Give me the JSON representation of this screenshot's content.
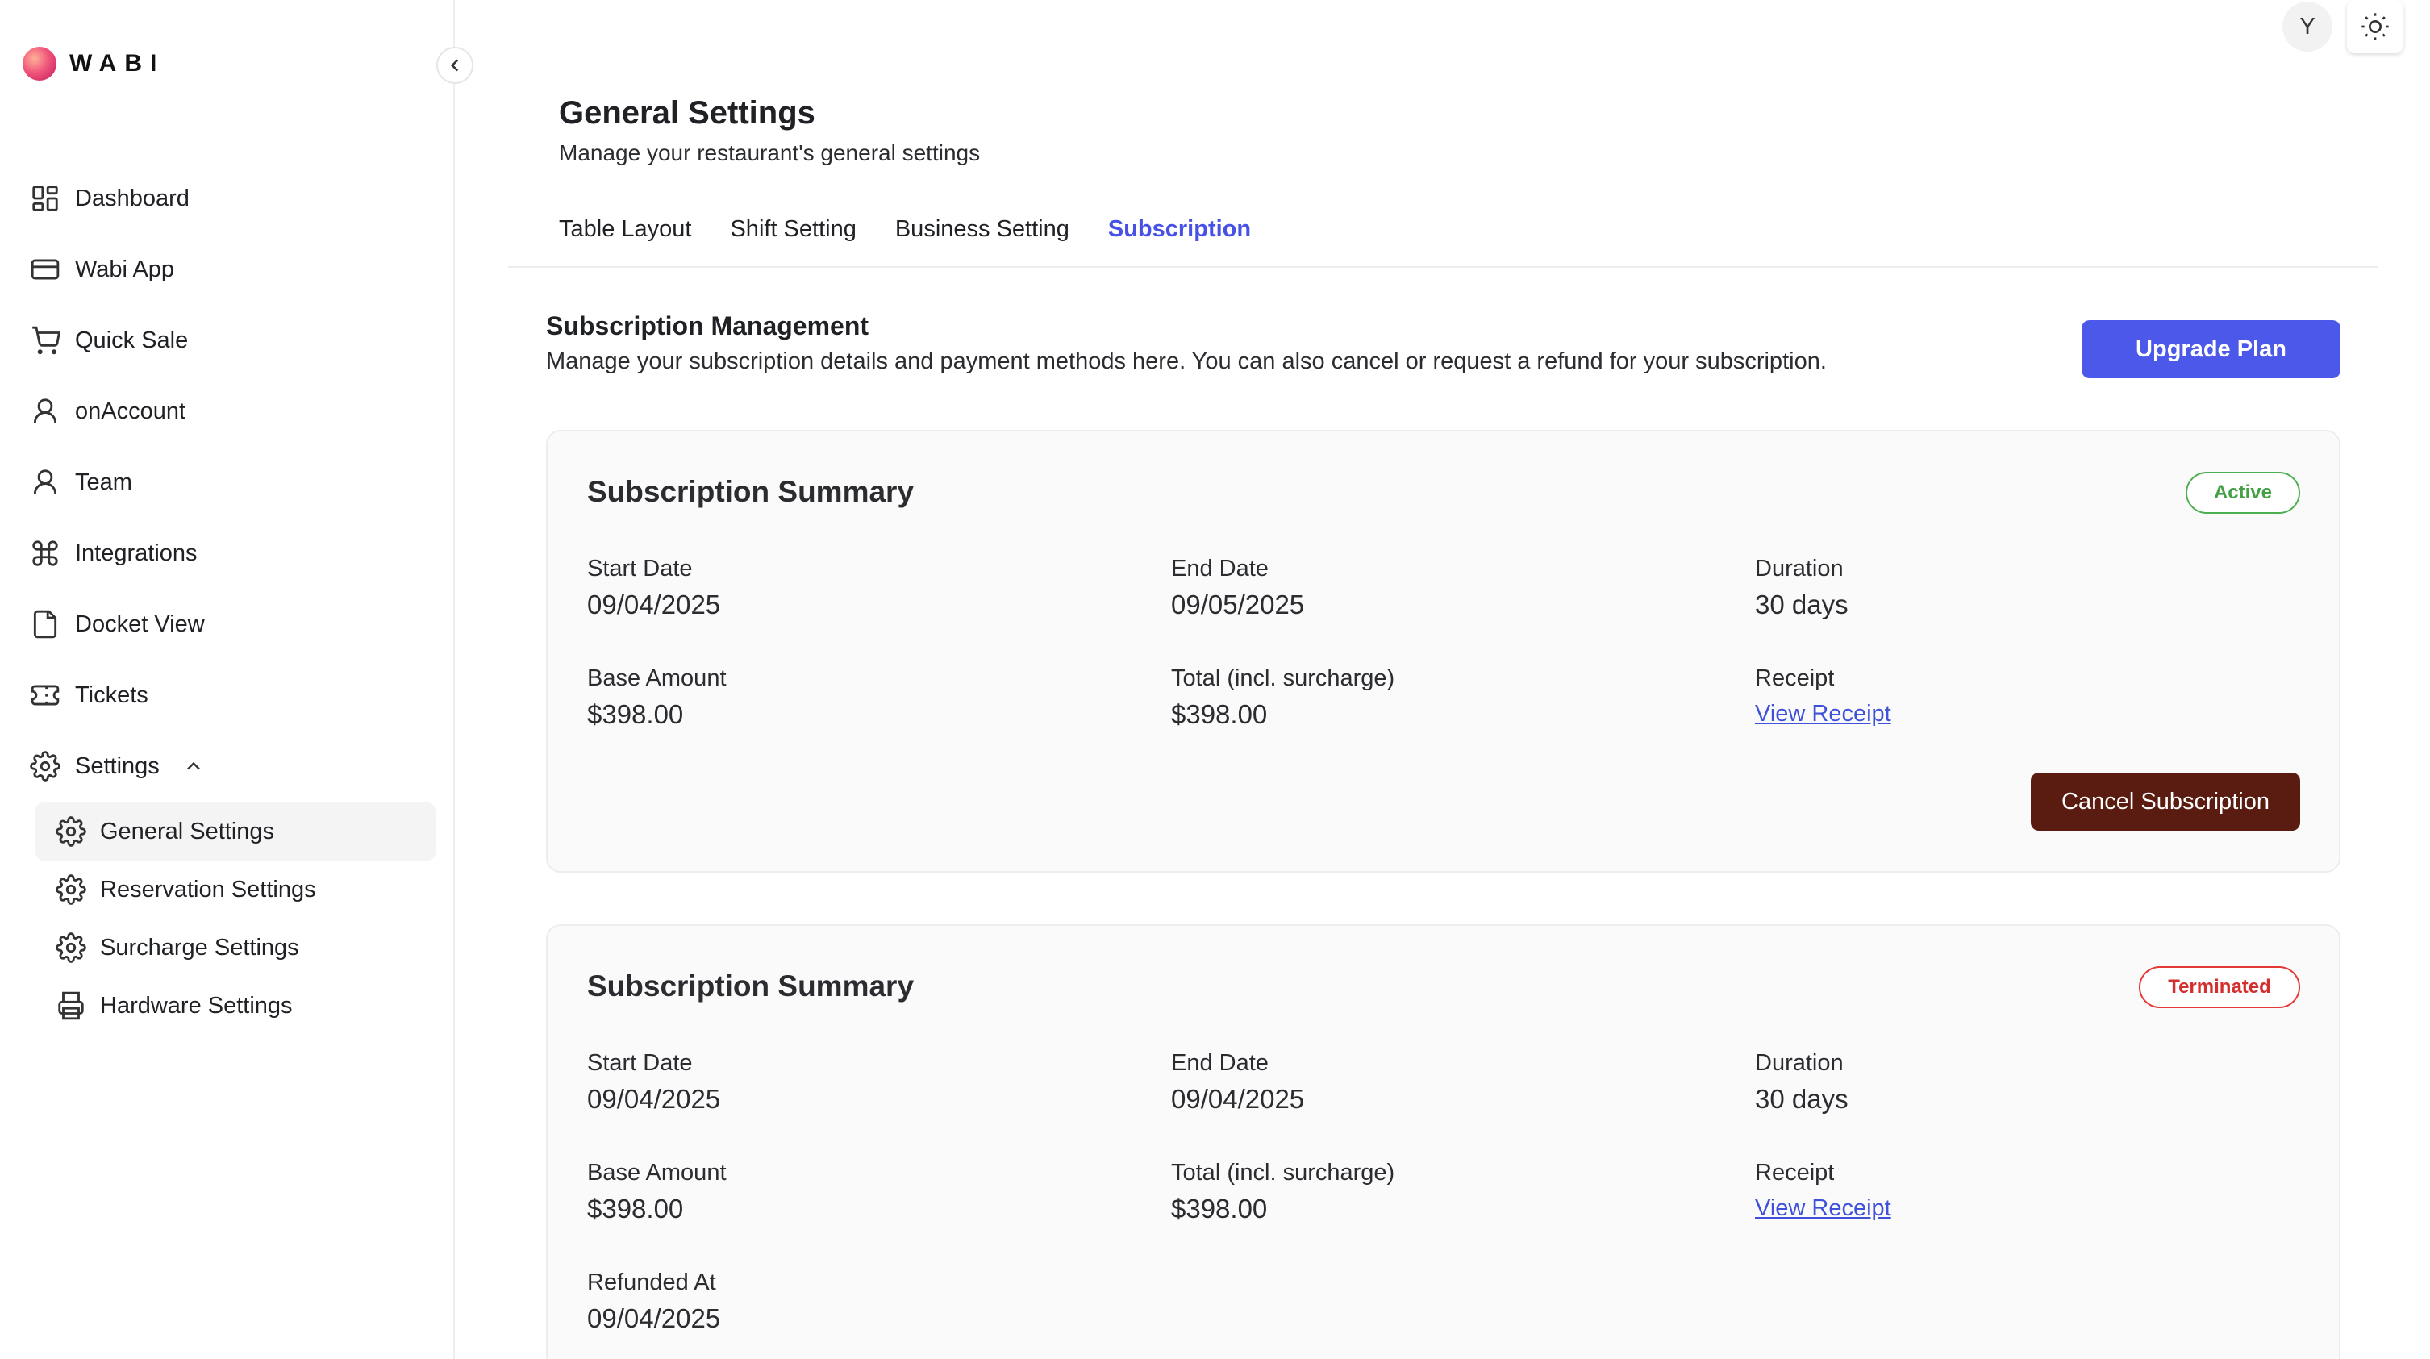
{
  "brand": {
    "name": "WABI"
  },
  "user": {
    "initial": "Y"
  },
  "sidebar": {
    "items": [
      {
        "label": "Dashboard",
        "icon": "dashboard-icon"
      },
      {
        "label": "Wabi App",
        "icon": "card-icon"
      },
      {
        "label": "Quick Sale",
        "icon": "cart-icon"
      },
      {
        "label": "onAccount",
        "icon": "user-icon"
      },
      {
        "label": "Team",
        "icon": "user-icon"
      },
      {
        "label": "Integrations",
        "icon": "command-icon"
      },
      {
        "label": "Docket View",
        "icon": "file-icon"
      },
      {
        "label": "Tickets",
        "icon": "ticket-icon"
      },
      {
        "label": "Settings",
        "icon": "gear-icon"
      }
    ],
    "settings_sub": [
      {
        "label": "General Settings",
        "icon": "gear-icon",
        "active": true
      },
      {
        "label": "Reservation Settings",
        "icon": "gear-icon"
      },
      {
        "label": "Surcharge Settings",
        "icon": "gear-icon"
      },
      {
        "label": "Hardware Settings",
        "icon": "printer-icon"
      }
    ]
  },
  "header": {
    "title": "General Settings",
    "subtitle": "Manage your restaurant's general settings"
  },
  "tabs": [
    {
      "label": "Table Layout",
      "active": false
    },
    {
      "label": "Shift Setting",
      "active": false
    },
    {
      "label": "Business Setting",
      "active": false
    },
    {
      "label": "Subscription",
      "active": true
    }
  ],
  "subscription_management": {
    "title": "Subscription Management",
    "description": "Manage your subscription details and payment methods here. You can also cancel or request a refund for your subscription.",
    "upgrade_label": "Upgrade Plan"
  },
  "labels": {
    "start_date": "Start Date",
    "end_date": "End Date",
    "duration": "Duration",
    "base_amount": "Base Amount",
    "total": "Total (incl. surcharge)",
    "receipt": "Receipt",
    "view_receipt": "View Receipt",
    "refunded_at": "Refunded At",
    "cancel_subscription": "Cancel Subscription"
  },
  "subscriptions": [
    {
      "title": "Subscription Summary",
      "status": "Active",
      "start_date": "09/04/2025",
      "end_date": "09/05/2025",
      "duration": "30 days",
      "base_amount": "$398.00",
      "total": "$398.00"
    },
    {
      "title": "Subscription Summary",
      "status": "Terminated",
      "start_date": "09/04/2025",
      "end_date": "09/04/2025",
      "duration": "30 days",
      "base_amount": "$398.00",
      "total": "$398.00",
      "refunded_at": "09/04/2025"
    }
  ],
  "colors": {
    "accent": "#4c58ea",
    "active_tab": "#4751e6",
    "cancel_button": "#5a1c10",
    "status_active": "#43a047",
    "status_terminated": "#d32f2f",
    "link": "#3f51d9"
  }
}
